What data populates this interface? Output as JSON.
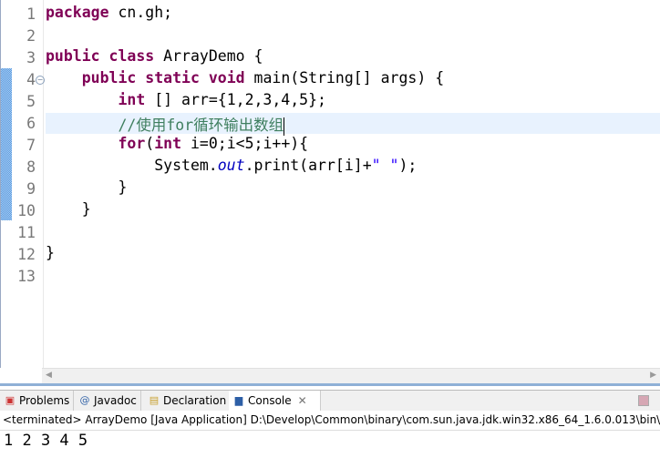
{
  "editor": {
    "line_numbers": [
      "1",
      "2",
      "3",
      "4",
      "5",
      "6",
      "7",
      "8",
      "9",
      "10",
      "11",
      "12",
      "13"
    ],
    "lines": [
      [
        {
          "t": "package",
          "c": "kw"
        },
        {
          "t": " cn.gh;",
          "c": ""
        }
      ],
      [],
      [
        {
          "t": "public",
          "c": "kw"
        },
        {
          "t": " ",
          "c": ""
        },
        {
          "t": "class",
          "c": "kw"
        },
        {
          "t": " ArrayDemo {",
          "c": ""
        }
      ],
      [
        {
          "t": "    ",
          "c": ""
        },
        {
          "t": "public",
          "c": "kw"
        },
        {
          "t": " ",
          "c": ""
        },
        {
          "t": "static",
          "c": "kw"
        },
        {
          "t": " ",
          "c": ""
        },
        {
          "t": "void",
          "c": "kw"
        },
        {
          "t": " main(String[] args) {",
          "c": ""
        }
      ],
      [
        {
          "t": "        ",
          "c": ""
        },
        {
          "t": "int",
          "c": "kw"
        },
        {
          "t": " [] arr={1,2,3,4,5};",
          "c": ""
        }
      ],
      [
        {
          "t": "        ",
          "c": ""
        },
        {
          "t": "//使用for循环输出数组",
          "c": "cm"
        }
      ],
      [
        {
          "t": "        ",
          "c": ""
        },
        {
          "t": "for",
          "c": "kw"
        },
        {
          "t": "(",
          "c": ""
        },
        {
          "t": "int",
          "c": "kw"
        },
        {
          "t": " i=0;i<5;i++){",
          "c": ""
        }
      ],
      [
        {
          "t": "            System.",
          "c": ""
        },
        {
          "t": "out",
          "c": "fld"
        },
        {
          "t": ".print(arr[i]+",
          "c": ""
        },
        {
          "t": "\" \"",
          "c": "str"
        },
        {
          "t": ");",
          "c": ""
        }
      ],
      [
        {
          "t": "        }",
          "c": ""
        }
      ],
      [
        {
          "t": "    }",
          "c": ""
        }
      ],
      [],
      [
        {
          "t": "}",
          "c": ""
        }
      ],
      []
    ],
    "current_line": 6
  },
  "tabs": [
    {
      "label": "Problems",
      "icon": "problems-icon"
    },
    {
      "label": "Javadoc",
      "icon": "at-icon"
    },
    {
      "label": "Declaration",
      "icon": "declaration-icon"
    },
    {
      "label": "Console",
      "icon": "console-icon",
      "active": true
    }
  ],
  "console": {
    "status": "<terminated> ArrayDemo [Java Application] D:\\Develop\\Common\\binary\\com.sun.java.jdk.win32.x86_64_1.6.0.013\\bin\\javaw.exe",
    "output": "1 2 3 4 5"
  }
}
